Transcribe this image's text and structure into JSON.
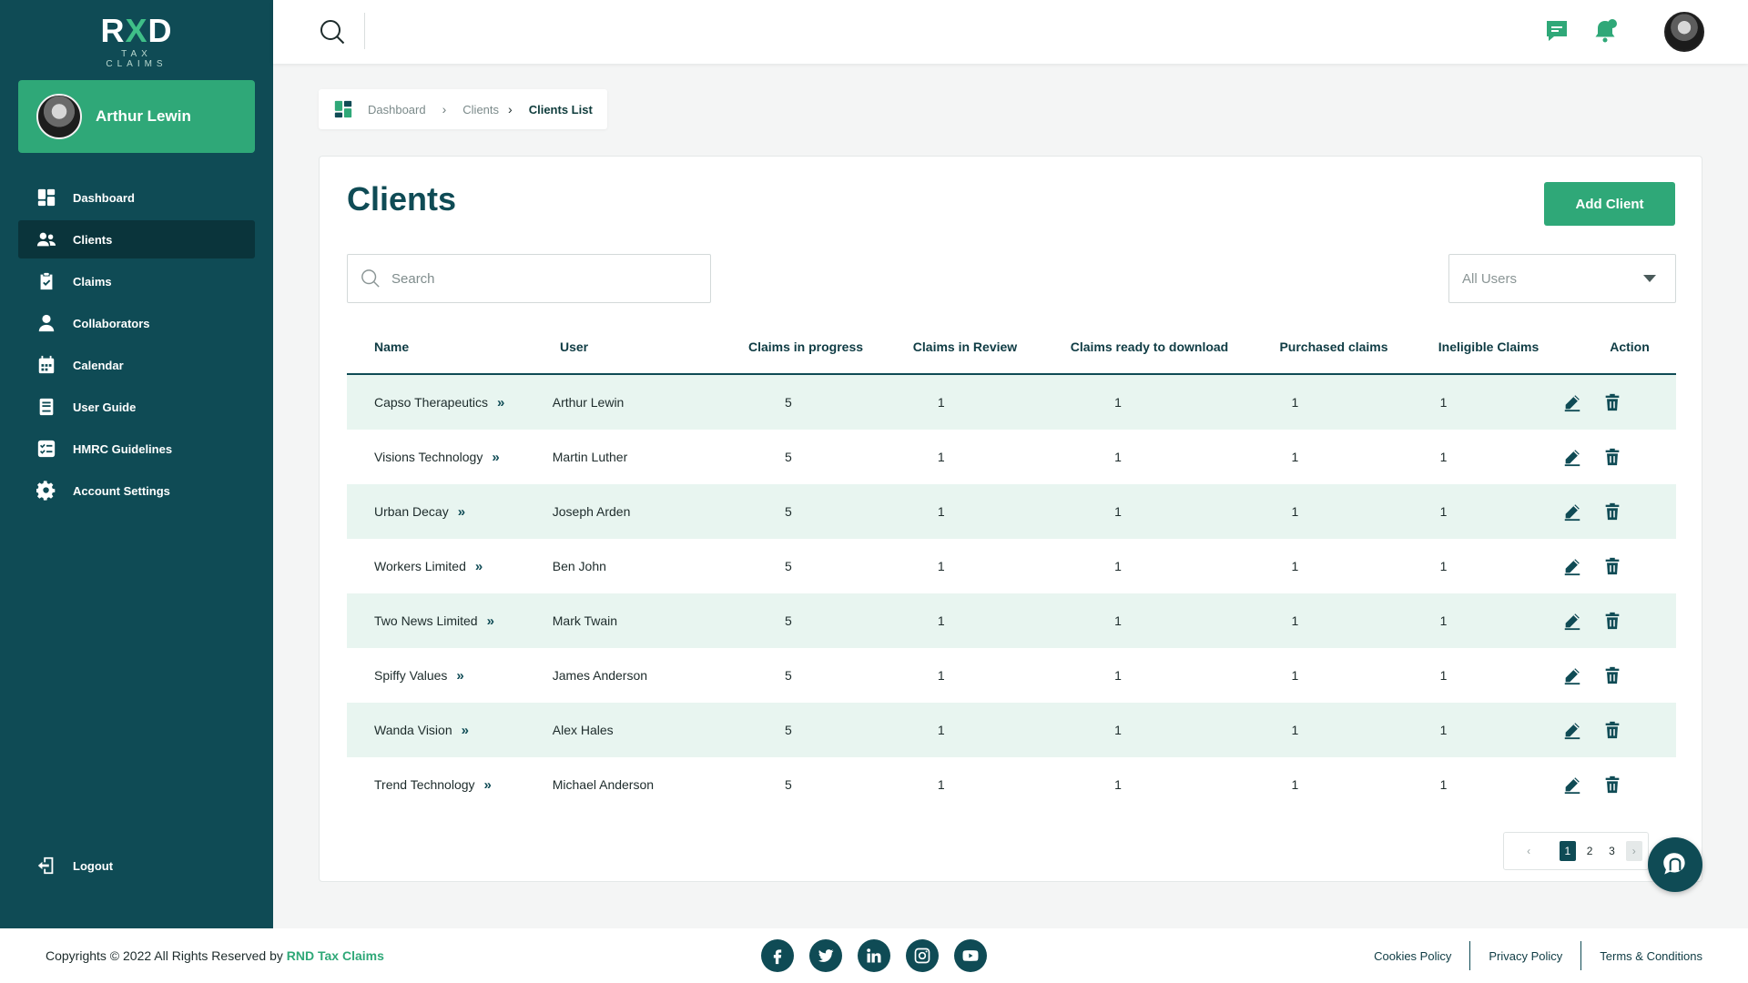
{
  "brand": {
    "logo_main_pre": "R",
    "logo_main_x": "X",
    "logo_main_post": "D",
    "logo_sub": "TAX CLAIMS"
  },
  "profile": {
    "name": "Arthur Lewin"
  },
  "sidebar": {
    "items": [
      {
        "label": "Dashboard",
        "icon": "dashboard-icon"
      },
      {
        "label": "Clients",
        "icon": "users-icon",
        "active": true
      },
      {
        "label": "Claims",
        "icon": "clipboard-check-icon"
      },
      {
        "label": "Collaborators",
        "icon": "user-icon"
      },
      {
        "label": "Calendar",
        "icon": "calendar-icon"
      },
      {
        "label": "User Guide",
        "icon": "book-icon"
      },
      {
        "label": "HMRC Guidelines",
        "icon": "checklist-icon"
      },
      {
        "label": "Account Settings",
        "icon": "gear-icon"
      }
    ],
    "logout": "Logout"
  },
  "breadcrumb": {
    "items": [
      "Dashboard",
      "Clients",
      "Clients List"
    ]
  },
  "page": {
    "title": "Clients",
    "add_button": "Add Client",
    "search_placeholder": "Search",
    "user_filter": "All Users"
  },
  "table": {
    "columns": [
      "Name",
      "User",
      "Claims in progress",
      "Claims in Review",
      "Claims ready to download",
      "Purchased claims",
      "Ineligible Claims",
      "Action"
    ],
    "rows": [
      {
        "name": "Capso Therapeutics",
        "user": "Arthur Lewin",
        "in_progress": "5",
        "in_review": "1",
        "ready": "1",
        "purchased": "1",
        "ineligible": "1"
      },
      {
        "name": "Visions Technology",
        "user": "Martin Luther",
        "in_progress": "5",
        "in_review": "1",
        "ready": "1",
        "purchased": "1",
        "ineligible": "1"
      },
      {
        "name": "Urban Decay",
        "user": "Joseph Arden",
        "in_progress": "5",
        "in_review": "1",
        "ready": "1",
        "purchased": "1",
        "ineligible": "1"
      },
      {
        "name": "Workers Limited",
        "user": "Ben John",
        "in_progress": "5",
        "in_review": "1",
        "ready": "1",
        "purchased": "1",
        "ineligible": "1"
      },
      {
        "name": "Two News Limited",
        "user": "Mark Twain",
        "in_progress": "5",
        "in_review": "1",
        "ready": "1",
        "purchased": "1",
        "ineligible": "1"
      },
      {
        "name": "Spiffy Values",
        "user": "James Anderson",
        "in_progress": "5",
        "in_review": "1",
        "ready": "1",
        "purchased": "1",
        "ineligible": "1"
      },
      {
        "name": "Wanda Vision",
        "user": "Alex Hales",
        "in_progress": "5",
        "in_review": "1",
        "ready": "1",
        "purchased": "1",
        "ineligible": "1"
      },
      {
        "name": "Trend Technology",
        "user": "Michael Anderson",
        "in_progress": "5",
        "in_review": "1",
        "ready": "1",
        "purchased": "1",
        "ineligible": "1"
      }
    ]
  },
  "pagination": {
    "prev": "‹",
    "pages": [
      "1",
      "2",
      "3"
    ],
    "current": "1",
    "next": "›"
  },
  "footer": {
    "copyright": "Copyrights © 2022 All Rights Reserved by",
    "company": "RND Tax Claims",
    "links": [
      "Cookies Policy",
      "Privacy Policy",
      "Terms & Conditions"
    ]
  },
  "colors": {
    "sidebar": "#0f4b55",
    "accent": "#2fa878",
    "row_alt": "#e8f5f0"
  }
}
